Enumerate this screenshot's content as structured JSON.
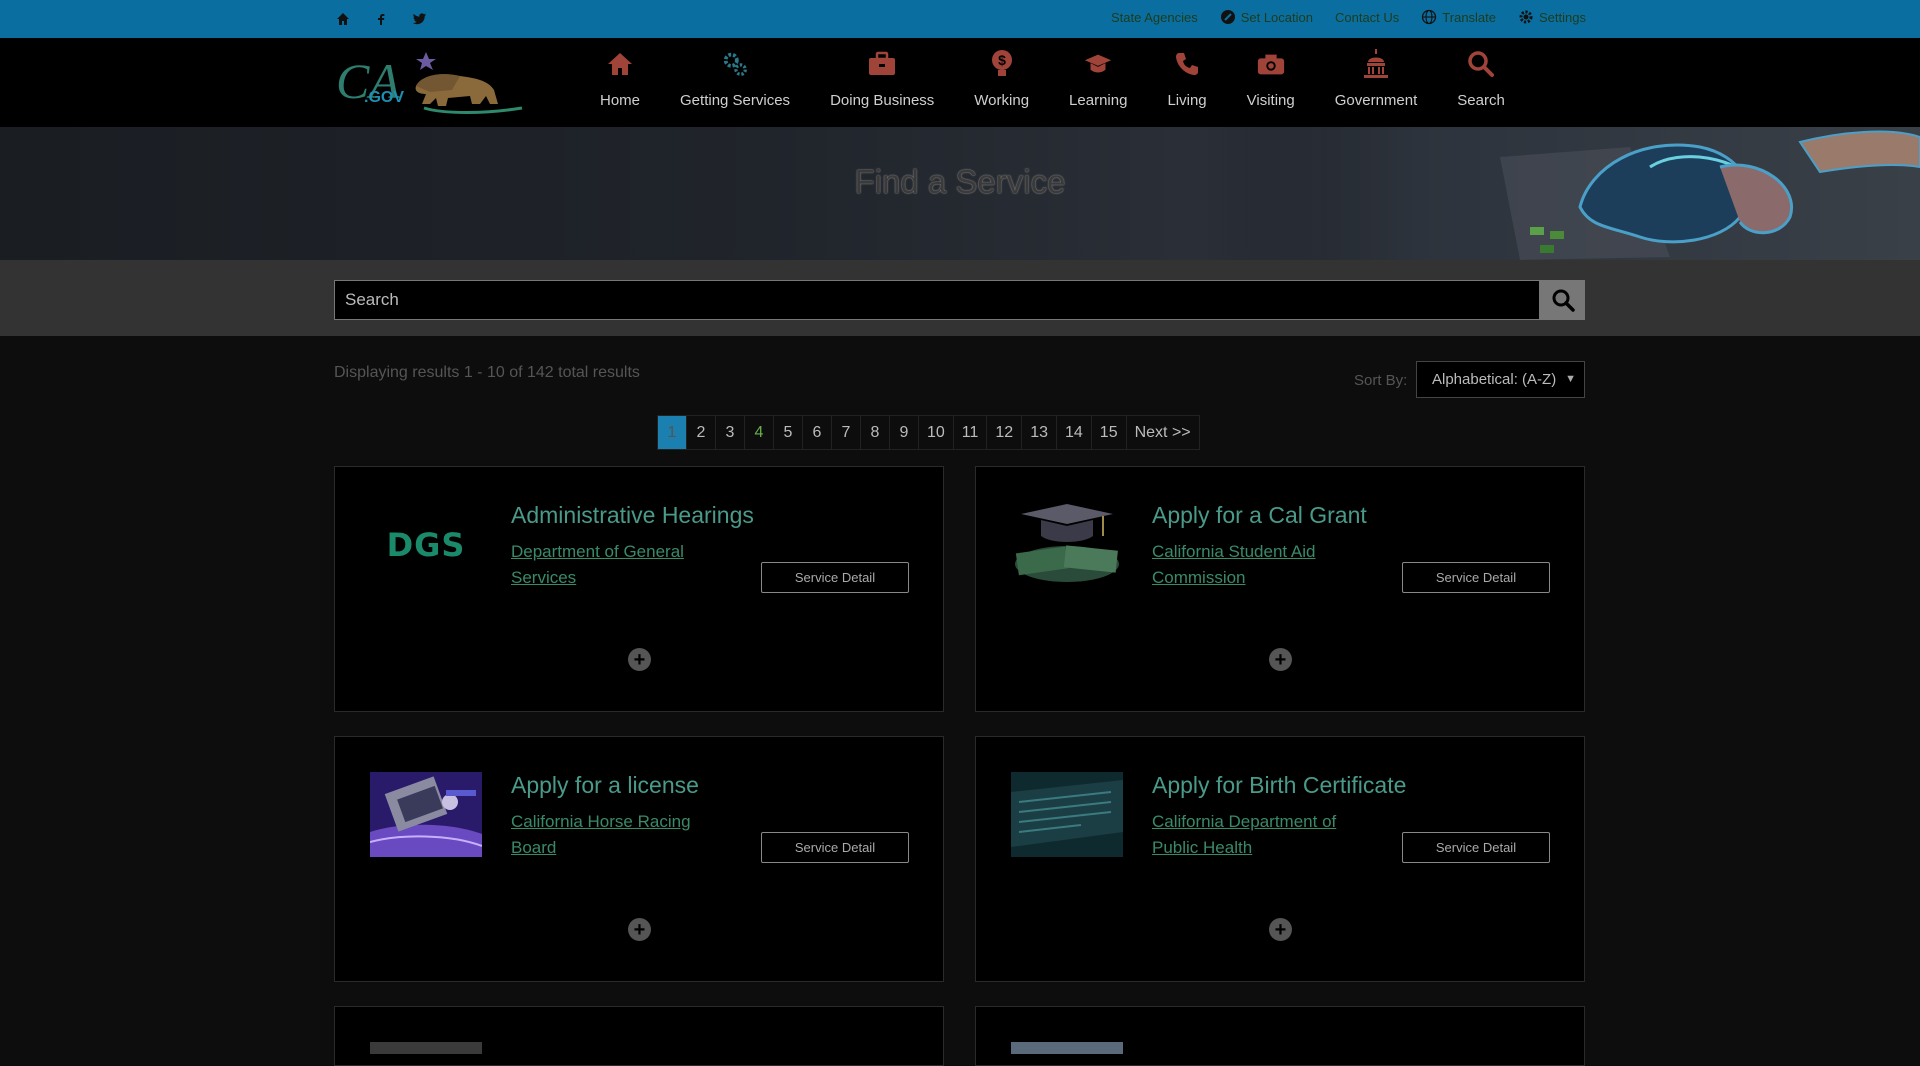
{
  "utility": {
    "links": [
      "State Agencies",
      "Set Location",
      "Contact Us",
      "Translate",
      "Settings"
    ]
  },
  "nav": {
    "items": [
      {
        "label": "Home",
        "icon": "home-icon"
      },
      {
        "label": "Getting Services",
        "icon": "gears-icon"
      },
      {
        "label": "Doing Business",
        "icon": "briefcase-icon"
      },
      {
        "label": "Working",
        "icon": "dollar-bulb-icon"
      },
      {
        "label": "Learning",
        "icon": "graduation-cap-icon"
      },
      {
        "label": "Living",
        "icon": "phone-icon"
      },
      {
        "label": "Visiting",
        "icon": "camera-icon"
      },
      {
        "label": "Government",
        "icon": "capitol-icon"
      },
      {
        "label": "Search",
        "icon": "search-icon"
      }
    ]
  },
  "hero": {
    "title": "Find a Service"
  },
  "search": {
    "placeholder": "Search"
  },
  "results": {
    "summary": "Displaying results 1 - 10 of 142 total results",
    "sort_label": "Sort By:",
    "sort_value": "Alphabetical: (A-Z)"
  },
  "pagination": {
    "pages": [
      "1",
      "2",
      "3",
      "4",
      "5",
      "6",
      "7",
      "8",
      "9",
      "10",
      "11",
      "12",
      "13",
      "14",
      "15"
    ],
    "next": "Next >>",
    "active": "1"
  },
  "cards": [
    {
      "title": "Administrative Hearings",
      "agency": "Department of General Services",
      "button": "Service Detail",
      "thumb": "DGS"
    },
    {
      "title": "Apply for a Cal Grant",
      "agency": "California Student Aid Commission",
      "button": "Service Detail",
      "thumb": ""
    },
    {
      "title": "Apply for a license",
      "agency": "California Horse Racing Board",
      "button": "Service Detail",
      "thumb": ""
    },
    {
      "title": "Apply for Birth Certificate",
      "agency": "California Department of Public Health",
      "button": "Service Detail",
      "thumb": ""
    }
  ],
  "colors": {
    "utility_bar": "#0a6fa0",
    "accent_active_page": "#1b7fb0",
    "link_teal": "#4a9a8a"
  }
}
